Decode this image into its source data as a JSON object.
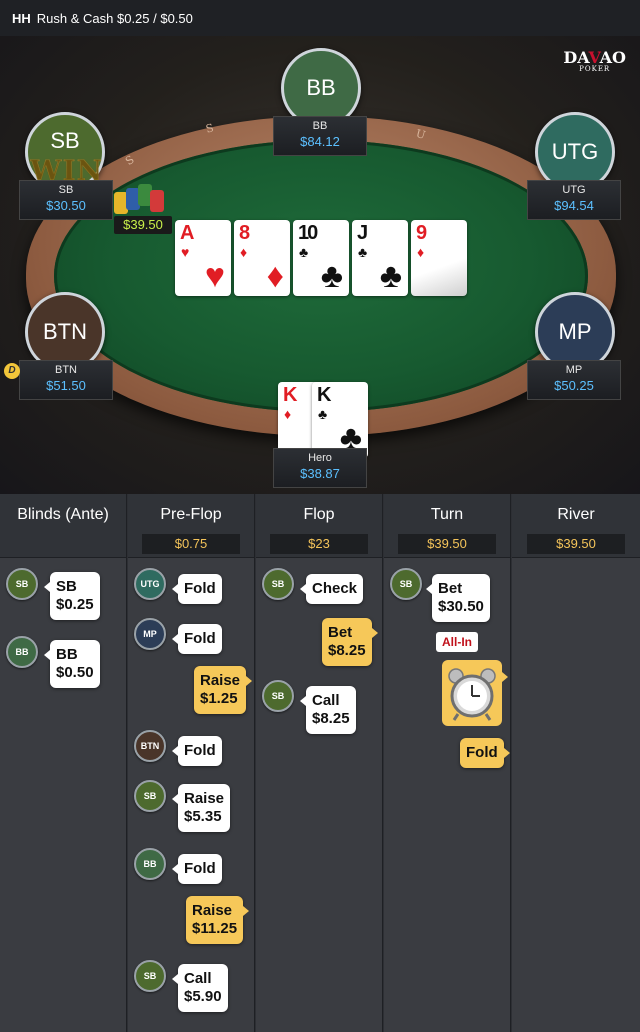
{
  "title": {
    "hh": "HH",
    "game": "Rush & Cash $0.25 / $0.50"
  },
  "logo": {
    "brand": "DAVAO",
    "sub": "POKER"
  },
  "table": {
    "rail_letters": [
      "S",
      "U",
      "S",
      "A",
      "S",
      "U",
      "S"
    ],
    "win_text": "WIN",
    "pot": "$39.50",
    "dealer_button": "D",
    "board": [
      {
        "rank": "A",
        "suit": "♥",
        "color": "red"
      },
      {
        "rank": "8",
        "suit": "♦",
        "color": "red"
      },
      {
        "rank": "10",
        "suit": "♣",
        "color": "black"
      },
      {
        "rank": "J",
        "suit": "♣",
        "color": "black"
      },
      {
        "rank": "9",
        "suit": "♦",
        "color": "red"
      }
    ],
    "hero_cards": [
      {
        "rank": "K",
        "suit": "♦",
        "color": "red"
      },
      {
        "rank": "K",
        "suit": "♣",
        "color": "black"
      }
    ],
    "seats": {
      "bb": {
        "label": "BB",
        "name": "BB",
        "stack": "$84.12",
        "color": "#3f6a45"
      },
      "sb": {
        "label": "SB",
        "name": "SB",
        "stack": "$30.50",
        "color": "#4d6a2e"
      },
      "utg": {
        "label": "UTG",
        "name": "UTG",
        "stack": "$94.54",
        "color": "#2f6b60"
      },
      "btn": {
        "label": "BTN",
        "name": "BTN",
        "stack": "$51.50",
        "color": "#4a3529"
      },
      "mp": {
        "label": "MP",
        "name": "MP",
        "stack": "$50.25",
        "color": "#2c3d57"
      },
      "hero": {
        "name": "Hero",
        "stack": "$38.87"
      }
    }
  },
  "streets": [
    {
      "name": "Blinds (Ante)",
      "pot": ""
    },
    {
      "name": "Pre-Flop",
      "pot": "$0.75"
    },
    {
      "name": "Flop",
      "pot": "$23"
    },
    {
      "name": "Turn",
      "pot": "$39.50"
    },
    {
      "name": "River",
      "pot": "$39.50"
    }
  ],
  "blinds_actions": [
    {
      "pos": "SB",
      "line1": "SB",
      "line2": "$0.25"
    },
    {
      "pos": "BB",
      "line1": "BB",
      "line2": "$0.50"
    }
  ],
  "preflop_actions": [
    {
      "pos": "UTG",
      "text": "Fold"
    },
    {
      "pos": "MP",
      "text": "Fold"
    },
    {
      "pos": "",
      "line1": "Raise",
      "line2": "$1.25"
    },
    {
      "pos": "BTN",
      "text": "Fold"
    },
    {
      "pos": "SB",
      "line1": "Raise",
      "line2": "$5.35"
    },
    {
      "pos": "BB",
      "text": "Fold"
    },
    {
      "pos": "",
      "line1": "Raise",
      "line2": "$11.25"
    },
    {
      "pos": "SB",
      "line1": "Call",
      "line2": "$5.90"
    }
  ],
  "flop_actions": [
    {
      "pos": "SB",
      "text": "Check"
    },
    {
      "pos": "",
      "line1": "Bet",
      "line2": "$8.25"
    },
    {
      "pos": "SB",
      "line1": "Call",
      "line2": "$8.25"
    }
  ],
  "turn_actions": [
    {
      "pos": "SB",
      "line1": "Bet",
      "line2": "$30.50"
    },
    {
      "badge": "All-In"
    },
    {
      "icon": "alarm-clock-icon"
    },
    {
      "pos": "",
      "text": "Fold"
    }
  ]
}
